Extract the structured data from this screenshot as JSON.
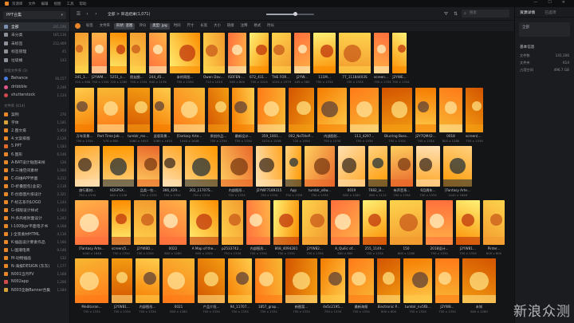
{
  "menubar": {
    "items": [
      "资源库",
      "文件",
      "编辑",
      "视图",
      "工具",
      "帮助"
    ],
    "window_controls": [
      "—",
      "☐",
      "✕"
    ]
  },
  "sidebar": {
    "library_name": "PPT合集",
    "main_items": [
      {
        "label": "全部",
        "count": "241,196",
        "icon": "all-icon",
        "color": "#7a8fb0",
        "active": true
      },
      {
        "label": "未分类",
        "count": "165,116",
        "icon": "uncategorized-icon",
        "color": "#8c9098"
      },
      {
        "label": "未标签",
        "count": "212,469",
        "icon": "untagged-icon",
        "color": "#8c9098"
      },
      {
        "label": "标签管理",
        "count": "45",
        "icon": "tag-manage-icon",
        "color": "#8c9098"
      },
      {
        "label": "垃圾桶",
        "count": "143",
        "icon": "trash-icon",
        "color": "#8c9098"
      }
    ],
    "smart_section": "智能文件夹 (3)",
    "smart_items": [
      {
        "label": "Behance",
        "count": "36,157",
        "color": "#4a7de0"
      },
      {
        "label": "dribbble",
        "count": "2,246",
        "color": "#e0568a"
      },
      {
        "label": "shutterstock",
        "count": "1,134",
        "color": "#d04a4a"
      }
    ],
    "folder_section": "文件夹 (614)",
    "folders": [
      {
        "label": "案例",
        "count": "276",
        "color": "#e8862a"
      },
      {
        "label": "字体",
        "count": "1,181",
        "color": "#d9a13a"
      },
      {
        "label": "2.图文排",
        "count": "5,858",
        "color": "#e8862a"
      },
      {
        "label": "4.文案排版",
        "count": "2,126",
        "color": "#e8862a"
      },
      {
        "label": "5.PPT",
        "count": "1,183",
        "color": "#e06a2a"
      },
      {
        "label": "6.图形",
        "count": "6,146",
        "color": "#e8862a"
      },
      {
        "label": "A-BAT设计贴图采样",
        "count": "126",
        "color": "#e8862a"
      },
      {
        "label": "B-三维空间素材",
        "count": "1,000",
        "color": "#e8862a"
      },
      {
        "label": "C-四维APP界面",
        "count": "3,212",
        "color": "#e8862a"
      },
      {
        "label": "D-折叠图包(含说)",
        "count": "2,118",
        "color": "#e8862a"
      },
      {
        "label": "E-创意图片排设计",
        "count": "2,321",
        "color": "#e8862a"
      },
      {
        "label": "F-标志系列LOGO",
        "count": "1,144",
        "color": "#e8862a"
      },
      {
        "label": "G-排版设计样式",
        "count": "1,163",
        "color": "#e8862a"
      },
      {
        "label": "H-多风格封面设计",
        "count": "1,242",
        "color": "#e8862a"
      },
      {
        "label": "I-100张pr平面电子书",
        "count": "4,168",
        "color": "#e8862a"
      },
      {
        "label": "J-全景素材HTML",
        "count": "4,116",
        "color": "#e8862a"
      },
      {
        "label": "K-插画设计要素作品",
        "count": "1,166",
        "color": "#e8862a"
      },
      {
        "label": "L-国潮电商",
        "count": "9,146",
        "color": "#e8862a"
      },
      {
        "label": "M-动物插画",
        "count": "132",
        "color": "#e8862a"
      },
      {
        "label": "N-海报DESIGN (东东)",
        "count": "1,177",
        "color": "#e8862a"
      },
      {
        "label": "N001当月PV",
        "count": "1,168",
        "color": "#e8862a"
      },
      {
        "label": "N002app",
        "count": "1,206",
        "color": "#d04a4a"
      },
      {
        "label": "N003全融Banner合集",
        "count": "1,184",
        "color": "#d9a13a"
      }
    ]
  },
  "toolbar": {
    "breadcrumb": "全部 > 筛选结果(1,071)",
    "search_placeholder": "搜索",
    "zoom_level": 0.6
  },
  "filters": {
    "items": [
      "标签",
      "文件夹",
      "形状: 竖图",
      "评分",
      "类型: jpg",
      "时间",
      "尺寸",
      "长宽",
      "大小",
      "链接",
      "注释",
      "格式",
      "时长"
    ],
    "active": [
      "形状: 竖图",
      "类型: jpg"
    ]
  },
  "right_panel": {
    "tabs": [
      "资源详情",
      "已选项"
    ],
    "box_label": "全部",
    "info_title": "基本信息",
    "rows": [
      {
        "k": "文件数",
        "v": "141,106"
      },
      {
        "k": "文件夹",
        "v": "614"
      },
      {
        "k": "占用空间",
        "v": "496.7 GB"
      }
    ]
  },
  "watermark": "新浪众测",
  "grid": {
    "rows": [
      {
        "items": [
          {
            "name": "241_11094...",
            "dim": "320 x 568"
          },
          {
            "name": "J2YWM4...",
            "dim": "750 x 1334"
          },
          {
            "name": "5251_ssdf.jpg",
            "dim": "720 x 1280"
          },
          {
            "name": "朋友圈配...",
            "dim": "750 x 1334"
          },
          {
            "name": "244_4545...",
            "dim": "640 x 1136"
          },
          {
            "name": "本的简图...",
            "dim": "750 x 1334"
          },
          {
            "name": "Owen Davey Ilu...",
            "dim": "710 x 1015"
          },
          {
            "name": "ISOFEN-Love...",
            "dim": "565 x 800"
          },
          {
            "name": "672_4116469",
            "dim": "700 x 1024"
          },
          {
            "name": "THE FORECAST...",
            "dim": "1024 x 1579"
          },
          {
            "name": "J2YW...",
            "dim": "445 x 580"
          },
          {
            "name": "111M...",
            "dim": "750 x 1334"
          },
          {
            "name": "77_11184403S",
            "dim": "750 x 1334"
          },
          {
            "name": "screen(52...",
            "dim": "750 x 1334"
          },
          {
            "name": "J2YWE...",
            "dim": "750 x 1334"
          }
        ]
      },
      {
        "items": [
          {
            "name": "万年背景...",
            "dim": "750 x 1334"
          },
          {
            "name": "Part Time Job Bar...",
            "dim": "576 x 600"
          },
          {
            "name": "tumblr_msV...",
            "dim": "1080 x 1920"
          },
          {
            "name": "竖版背景...",
            "dim": "1080 x 1920"
          },
          {
            "name": "[Fantasy Arte...",
            "dim": "1440 x 1648"
          },
          {
            "name": "原创作品...",
            "dim": "750 x 1334"
          },
          {
            "name": "最新设计...",
            "dim": "750 x 1334"
          },
          {
            "name": "359_1001...",
            "dim": "1024 x 1536"
          },
          {
            "name": "002_NoTitlePic...",
            "dim": "720 x 1054"
          },
          {
            "name": "内部图形...",
            "dim": "750 x 1334"
          },
          {
            "name": "113_4297...",
            "dim": "750 x 1334"
          },
          {
            "name": "Blurring Boss...",
            "dim": "750 x 1334"
          },
          {
            "name": "J2Y7QM42...",
            "dim": "750 x 1334"
          },
          {
            "name": "0018",
            "dim": "800 x 1280"
          },
          {
            "name": "screen(52...",
            "dim": "750 x 1334"
          }
        ]
      },
      {
        "items": [
          {
            "name": "旅行素材...",
            "dim": "750 x 1334"
          },
          {
            "name": "KDSPSX...",
            "dim": "640 x 1136"
          },
          {
            "name": "品类一些...",
            "dim": "750 x 1334"
          },
          {
            "name": "366_4293...",
            "dim": "750 x 1334"
          },
          {
            "name": "202_11707S...",
            "dim": "750 x 1334"
          },
          {
            "name": "内部图形...",
            "dim": "750 x 1334"
          },
          {
            "name": "J2YWF7189315",
            "dim": "750 x 1334"
          },
          {
            "name": "App",
            "dim": "750 x 1334"
          },
          {
            "name": "tumblr_o6w...",
            "dim": "750 x 1334"
          },
          {
            "name": "0019",
            "dim": "800 x 1280"
          },
          {
            "name": "7682_iam-fr...",
            "dim": "800 x 1112"
          },
          {
            "name": "有声音系...",
            "dim": "750 x 1334"
          },
          {
            "name": "6月周年...",
            "dim": "750 x 1334"
          },
          {
            "name": "[Fantasy Arte...",
            "dim": "1440 x 1648"
          }
        ]
      },
      {
        "items": [
          {
            "name": "[Fantasy Arte...",
            "dim": "1440 x 1648"
          },
          {
            "name": "screen(52...",
            "dim": "750 x 1334"
          },
          {
            "name": "J2YW8D...",
            "dim": "750 x 1334"
          },
          {
            "name": "0022",
            "dim": "800 x 1280"
          },
          {
            "name": "A Map of the...",
            "dim": "600 x 1024"
          },
          {
            "name": "p253374204...",
            "dim": "750 x 1334"
          },
          {
            "name": "内部图形...",
            "dim": "750 x 1334"
          },
          {
            "name": "868_4094281",
            "dim": "750 x 1334"
          },
          {
            "name": "J2YW82...",
            "dim": "750 x 1334"
          },
          {
            "name": "A_Quilic of...",
            "dim": "600 x 800"
          },
          {
            "name": "255_1149...",
            "dim": "750 x 1334"
          },
          {
            "name": "150",
            "dim": "800 x 1280"
          },
          {
            "name": "2018设计...",
            "dim": "750 x 1334"
          },
          {
            "name": "J2YW81...",
            "dim": "750 x 1334"
          },
          {
            "name": "Pinter...",
            "dim": "600 x 800"
          }
        ]
      },
      {
        "items": [
          {
            "name": "Meditoran...",
            "dim": "750 x 1334"
          },
          {
            "name": "J2YW81...",
            "dim": "750 x 1334"
          },
          {
            "name": "内部图形...",
            "dim": "750 x 1334"
          },
          {
            "name": "0021",
            "dim": "800 x 1280"
          },
          {
            "name": "产品介绍...",
            "dim": "750 x 1334"
          },
          {
            "name": "94_11707...",
            "dim": "750 x 1334"
          },
          {
            "name": "1857_grap...",
            "dim": "750 x 1334"
          },
          {
            "name": "新图案...",
            "dim": "750 x 1334"
          },
          {
            "name": "4e5c2195...",
            "dim": "750 x 1334"
          },
          {
            "name": "最新海报",
            "dim": "750 x 1334"
          },
          {
            "name": "Electronic P...",
            "dim": "600 x 800"
          },
          {
            "name": "tumblr_nv5fB...",
            "dim": "750 x 1334"
          },
          {
            "name": "J2YW8...",
            "dim": "750 x 1334"
          },
          {
            "name": "未知",
            "dim": "800 x 1280"
          }
        ]
      }
    ]
  }
}
